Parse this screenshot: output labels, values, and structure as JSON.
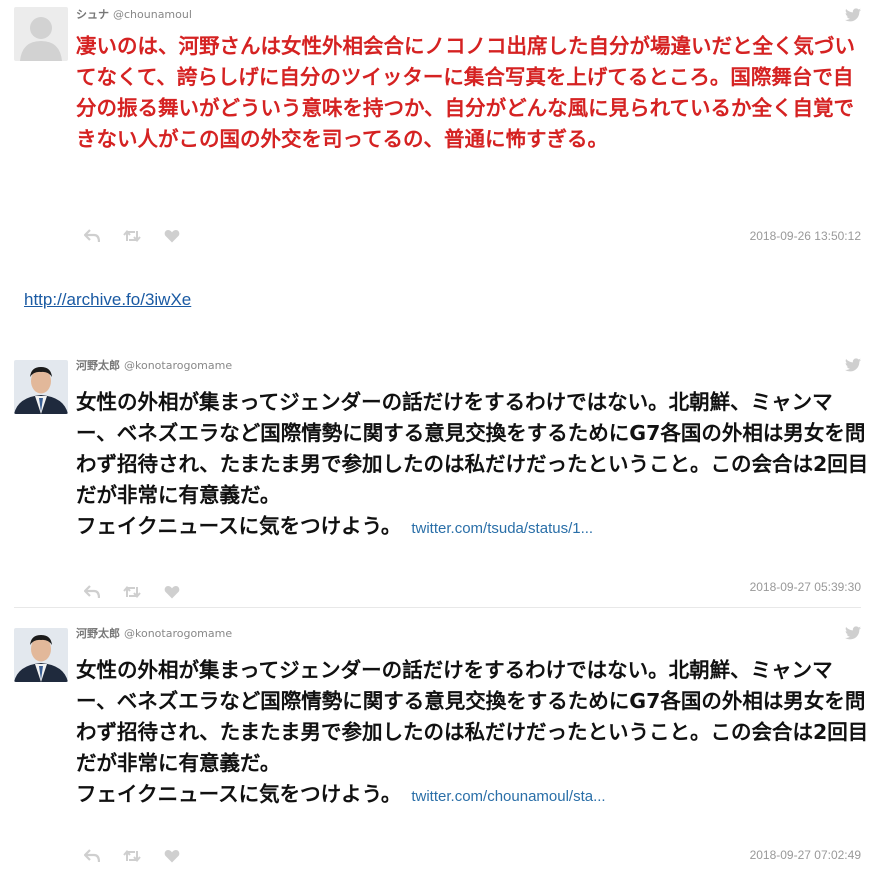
{
  "tweets": [
    {
      "display_name": "シュナ",
      "handle": "@chounamoul",
      "text": "凄いのは、河野さんは女性外相会合にノコノコ出席した自分が場違いだと全く気づいてなくて、誇らしげに自分のツイッターに集合写真を上げてるところ。国際舞台で自分の振る舞いがどういう意味を持つか、自分がどんな風に見られているか全く自覚できない人がこの国の外交を司ってるの、普通に怖すぎる。",
      "timestamp": "2018-09-26 13:50:12",
      "text_color": "#d52222"
    },
    {
      "display_name": "河野太郎",
      "handle": "@konotarogomame",
      "text": "女性の外相が集まってジェンダーの話だけをするわけではない。北朝鮮、ミャンマー、ベネズエラなど国際情勢に関する意見交換をするためにG7各国の外相は男女を問わず招待され、たまたま男で参加したのは私だけだったということ。この会合は2回目だが非常に有意義だ。",
      "text_line2": "フェイクニュースに気をつけよう。",
      "link": "twitter.com/tsuda/status/1...",
      "timestamp": "2018-09-27 05:39:30"
    },
    {
      "display_name": "河野太郎",
      "handle": "@konotarogomame",
      "text": "女性の外相が集まってジェンダーの話だけをするわけではない。北朝鮮、ミャンマー、ベネズエラなど国際情勢に関する意見交換をするためにG7各国の外相は男女を問わず招待され、たまたま男で参加したのは私だけだったということ。この会合は2回目だが非常に有意義だ。",
      "text_line2": "フェイクニュースに気をつけよう。",
      "link": "twitter.com/chounamoul/sta...",
      "timestamp": "2018-09-27 07:02:49"
    }
  ],
  "archive_link": "http://archive.fo/3iwXe",
  "icons": [
    "default-avatar-icon",
    "twitter-bird-icon",
    "reply-icon",
    "retweet-icon",
    "like-icon"
  ],
  "colors": {
    "accent_red": "#d52222",
    "link_blue": "#2a6fa8"
  }
}
